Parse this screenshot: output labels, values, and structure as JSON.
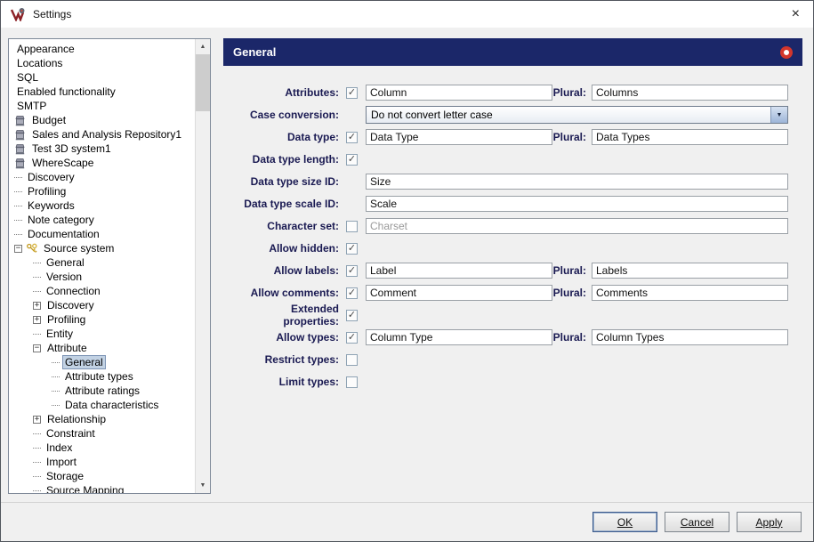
{
  "window": {
    "title": "Settings",
    "close": "×"
  },
  "colors": {
    "header_bg": "#1b2769",
    "accent_red": "#d3362c",
    "selection_bg": "#c2d2e4",
    "label_text": "#1a1a52"
  },
  "tree": {
    "items": [
      {
        "label": "Appearance",
        "indent": 0,
        "icon": "none",
        "expander": "none",
        "dash": false,
        "selected": false
      },
      {
        "label": "Locations",
        "indent": 0,
        "icon": "none",
        "expander": "none",
        "dash": false,
        "selected": false
      },
      {
        "label": "SQL",
        "indent": 0,
        "icon": "none",
        "expander": "none",
        "dash": false,
        "selected": false
      },
      {
        "label": "Enabled functionality",
        "indent": 0,
        "icon": "none",
        "expander": "none",
        "dash": false,
        "selected": false
      },
      {
        "label": "SMTP",
        "indent": 0,
        "icon": "none",
        "expander": "none",
        "dash": false,
        "selected": false
      },
      {
        "label": "Budget",
        "indent": 0,
        "icon": "repo",
        "expander": "none",
        "dash": false,
        "selected": false
      },
      {
        "label": "Sales and Analysis Repository1",
        "indent": 0,
        "icon": "repo",
        "expander": "none",
        "dash": false,
        "selected": false
      },
      {
        "label": "Test 3D system1",
        "indent": 0,
        "icon": "repo",
        "expander": "none",
        "dash": false,
        "selected": false
      },
      {
        "label": "WhereScape",
        "indent": 0,
        "icon": "repo",
        "expander": "none",
        "dash": false,
        "selected": false
      },
      {
        "label": "Discovery",
        "indent": 0,
        "icon": "none",
        "expander": "none",
        "dash": true,
        "selected": false
      },
      {
        "label": "Profiling",
        "indent": 0,
        "icon": "none",
        "expander": "none",
        "dash": true,
        "selected": false
      },
      {
        "label": "Keywords",
        "indent": 0,
        "icon": "none",
        "expander": "none",
        "dash": true,
        "selected": false
      },
      {
        "label": "Note category",
        "indent": 0,
        "icon": "none",
        "expander": "none",
        "dash": true,
        "selected": false
      },
      {
        "label": "Documentation",
        "indent": 0,
        "icon": "none",
        "expander": "none",
        "dash": true,
        "selected": false
      },
      {
        "label": "Source system",
        "indent": 0,
        "icon": "keys",
        "expander": "minus",
        "dash": false,
        "selected": false
      },
      {
        "label": "General",
        "indent": 1,
        "icon": "none",
        "expander": "none",
        "dash": true,
        "selected": false
      },
      {
        "label": "Version",
        "indent": 1,
        "icon": "none",
        "expander": "none",
        "dash": true,
        "selected": false
      },
      {
        "label": "Connection",
        "indent": 1,
        "icon": "none",
        "expander": "none",
        "dash": true,
        "selected": false
      },
      {
        "label": "Discovery",
        "indent": 1,
        "icon": "none",
        "expander": "plus",
        "dash": false,
        "selected": false
      },
      {
        "label": "Profiling",
        "indent": 1,
        "icon": "none",
        "expander": "plus",
        "dash": false,
        "selected": false
      },
      {
        "label": "Entity",
        "indent": 1,
        "icon": "none",
        "expander": "none",
        "dash": true,
        "selected": false
      },
      {
        "label": "Attribute",
        "indent": 1,
        "icon": "none",
        "expander": "minus",
        "dash": false,
        "selected": false
      },
      {
        "label": "General",
        "indent": 2,
        "icon": "none",
        "expander": "none",
        "dash": true,
        "selected": true
      },
      {
        "label": "Attribute types",
        "indent": 2,
        "icon": "none",
        "expander": "none",
        "dash": true,
        "selected": false
      },
      {
        "label": "Attribute ratings",
        "indent": 2,
        "icon": "none",
        "expander": "none",
        "dash": true,
        "selected": false
      },
      {
        "label": "Data characteristics",
        "indent": 2,
        "icon": "none",
        "expander": "none",
        "dash": true,
        "selected": false
      },
      {
        "label": "Relationship",
        "indent": 1,
        "icon": "none",
        "expander": "plus",
        "dash": false,
        "selected": false
      },
      {
        "label": "Constraint",
        "indent": 1,
        "icon": "none",
        "expander": "none",
        "dash": true,
        "selected": false
      },
      {
        "label": "Index",
        "indent": 1,
        "icon": "none",
        "expander": "none",
        "dash": true,
        "selected": false
      },
      {
        "label": "Import",
        "indent": 1,
        "icon": "none",
        "expander": "none",
        "dash": true,
        "selected": false
      },
      {
        "label": "Storage",
        "indent": 1,
        "icon": "none",
        "expander": "none",
        "dash": true,
        "selected": false
      },
      {
        "label": "Source Mapping",
        "indent": 1,
        "icon": "none",
        "expander": "none",
        "dash": true,
        "selected": false
      }
    ]
  },
  "panel": {
    "title": "General"
  },
  "form": {
    "rows": [
      {
        "type": "pair",
        "label": "Attributes:",
        "checkbox": true,
        "checked": true,
        "value": "Column",
        "plural_label": "Plural:",
        "plural_value": "Columns"
      },
      {
        "type": "combo",
        "label": "Case conversion:",
        "checkbox": false,
        "value": "Do not convert letter case"
      },
      {
        "type": "pair",
        "label": "Data type:",
        "checkbox": true,
        "checked": true,
        "value": "Data Type",
        "plural_label": "Plural:",
        "plural_value": "Data Types"
      },
      {
        "type": "check",
        "label": "Data type length:",
        "checkbox": true,
        "checked": true
      },
      {
        "type": "wide",
        "label": "Data type size ID:",
        "checkbox": false,
        "value": "Size"
      },
      {
        "type": "wide",
        "label": "Data type scale ID:",
        "checkbox": false,
        "value": "Scale"
      },
      {
        "type": "wide",
        "label": "Character set:",
        "checkbox": true,
        "checked": false,
        "value": "",
        "placeholder": "Charset"
      },
      {
        "type": "check",
        "label": "Allow hidden:",
        "checkbox": true,
        "checked": true
      },
      {
        "type": "pair",
        "label": "Allow labels:",
        "checkbox": true,
        "checked": true,
        "value": "Label",
        "plural_label": "Plural:",
        "plural_value": "Labels"
      },
      {
        "type": "pair",
        "label": "Allow comments:",
        "checkbox": true,
        "checked": true,
        "value": "Comment",
        "plural_label": "Plural:",
        "plural_value": "Comments"
      },
      {
        "type": "check",
        "label": "Extended properties:",
        "checkbox": true,
        "checked": true
      },
      {
        "type": "pair",
        "label": "Allow types:",
        "checkbox": true,
        "checked": true,
        "value": "Column Type",
        "plural_label": "Plural:",
        "plural_value": "Column Types"
      },
      {
        "type": "check",
        "label": "Restrict types:",
        "checkbox": true,
        "checked": false
      },
      {
        "type": "check",
        "label": "Limit types:",
        "checkbox": true,
        "checked": false
      }
    ]
  },
  "footer": {
    "buttons": [
      {
        "label": "OK",
        "default": true
      },
      {
        "label": "Cancel",
        "default": false
      },
      {
        "label": "Apply",
        "default": false
      }
    ]
  }
}
